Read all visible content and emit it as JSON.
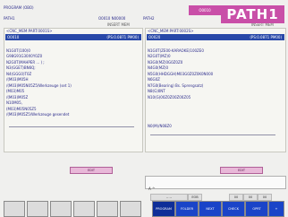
{
  "header": {
    "top_left": "PROGRAM (OBO)",
    "left_label": "PATH1",
    "mid_label": "O0010 N00000",
    "mid_label2": "PATH2",
    "right_label2": "O0020 N00000",
    "insert_left": "INSERT MEM",
    "insert_right": "INSERT MEM",
    "mode_badge": "O0010",
    "path_badge": "PATH1"
  },
  "left_pane": {
    "head": "<CNC_MEM:PART:0001S>",
    "selected_left": "O0010",
    "selected_right": "(PS:0.0871 PM00)",
    "lines": [
      "",
      "N1G0T(100)0",
      "G98G91G30X0Y0Z0",
      "N2G0T(MAHPER ... ) ;",
      "N3(GGET)BN6Q;",
      "N4(GGG0)T0Z",
      "/(M03)M05H",
      "/(M03)M05N05Z5/Werkzeuge (set 1)",
      "(M03)M05",
      "/(M03)M05Z",
      "N10M05,",
      "(M03)M05N05Z5",
      "/(M03)M05Z5/Werkzeuge gesendet",
      "",
      ""
    ]
  },
  "right_pane": {
    "head": "<CNC_MEM:PART:0002S>",
    "selected_left": "O0020",
    "selected_right": "(PS:0.0871 PM00)",
    "lines": [
      "",
      "N1G0T(ZE00-KARAOKE)100ZE0",
      "N2G0T(MZ)0",
      "N3G0(MZ)0G0Z0Z0",
      "N4G0(MZ)0",
      "N5G0(HHDGGH)M03G0Z0Z0K0N000",
      "N6G0Z",
      "N7G0(Bearing) Bs. Sprengsatz)",
      "N8(G)0NT",
      "N10(G)00Z0Z00Z00Z05",
      "",
      "",
      "",
      "",
      "N0(M)/N08Z0"
    ]
  },
  "buttons": {
    "left_pink": "EDIT",
    "right_pink": "EDIT"
  },
  "input": {
    "value": "A ^"
  },
  "status": {
    "left_cell": "-- --",
    "mid_cell": "EOB",
    "right_cells": [
      "00",
      "00",
      "00"
    ]
  },
  "softkeys": {
    "keys": [
      "",
      "",
      "",
      "",
      "",
      "",
      "PROGRAM",
      "FOLDER",
      "NEXT",
      "CHECK",
      "OPRT",
      "+"
    ]
  },
  "colors": {
    "accent_magenta": "#c94fa8",
    "selection_blue": "#2848a8",
    "softkey_blue": "#1a44c8"
  }
}
